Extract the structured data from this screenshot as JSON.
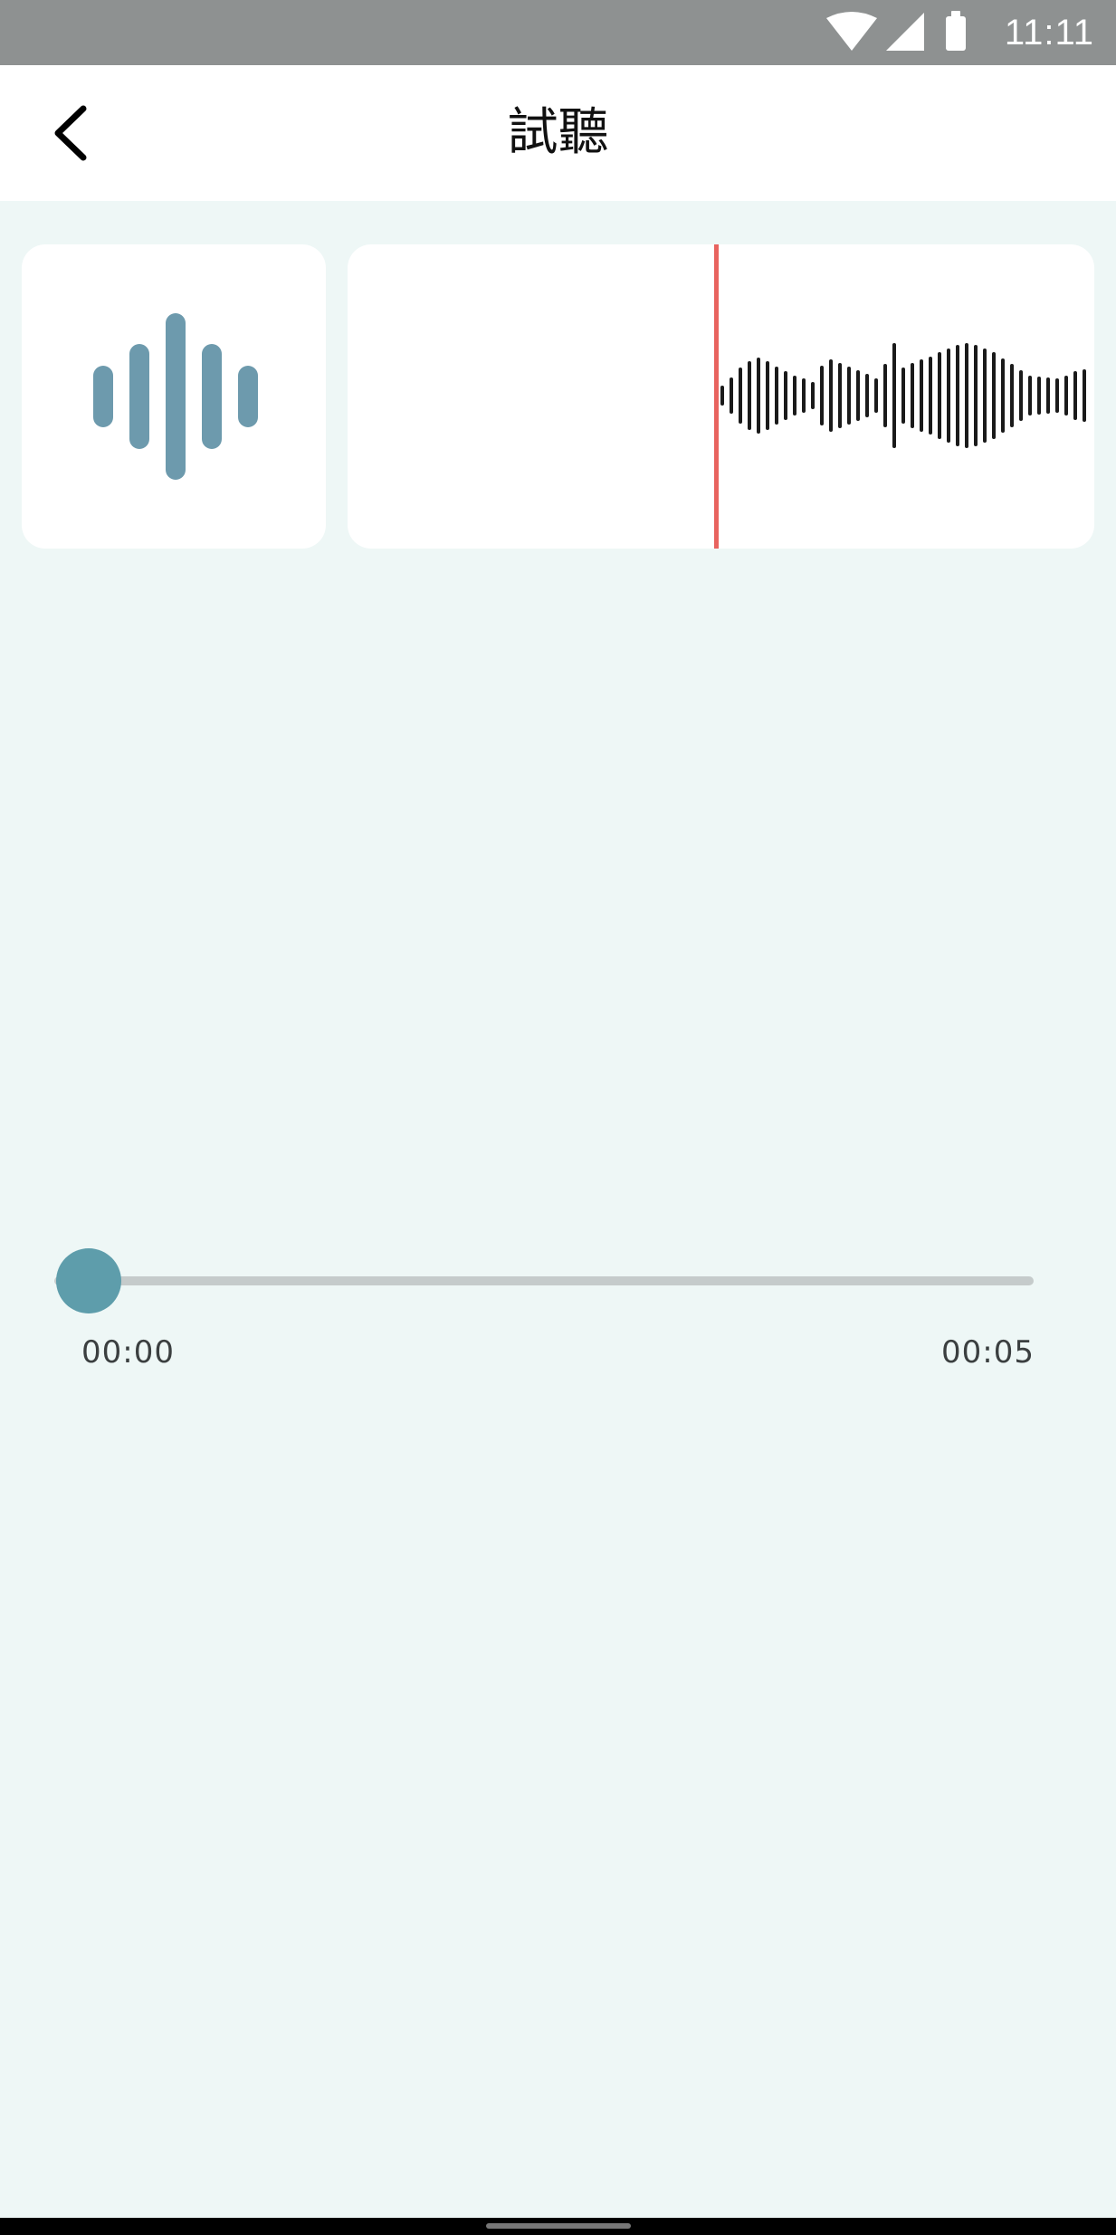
{
  "status_bar": {
    "time": "11:11",
    "icons": [
      "wifi-icon",
      "cell-signal-icon",
      "battery-icon"
    ]
  },
  "header": {
    "title": "試聽",
    "back_icon": "chevron-left-icon"
  },
  "audio_icon": "audio-waveform-icon",
  "waveform": {
    "playhead_color": "#e8635f",
    "bar_color": "#1a1a1a"
  },
  "player": {
    "current_time": "00:00",
    "total_time": "00:05",
    "progress": 0,
    "accent_color": "#5e9dab"
  },
  "colors": {
    "background": "#eef7f6",
    "icon_bars": "#6d9aad"
  }
}
